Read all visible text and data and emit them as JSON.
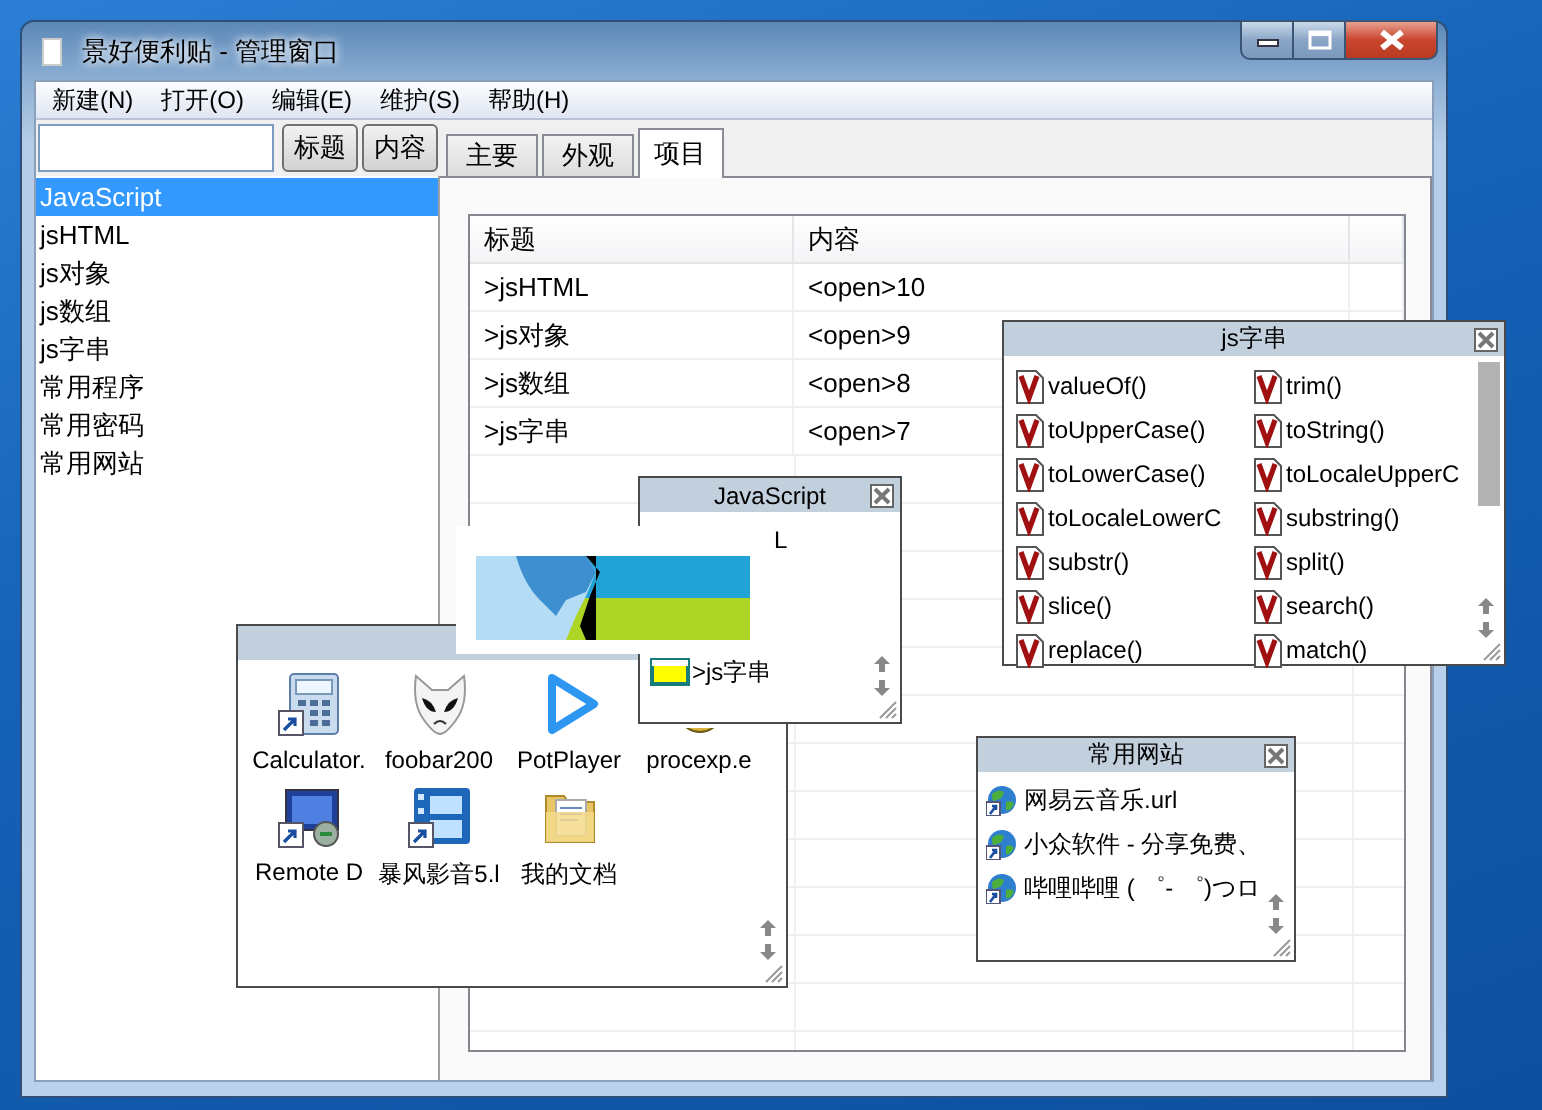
{
  "window": {
    "title": "景好便利贴 - 管理窗口"
  },
  "menu": [
    {
      "label": "新建(N)"
    },
    {
      "label": "打开(O)"
    },
    {
      "label": "编辑(E)"
    },
    {
      "label": "维护(S)"
    },
    {
      "label": "帮助(H)"
    }
  ],
  "search_buttons": [
    "标题",
    "内容"
  ],
  "tabs": [
    {
      "label": "主要",
      "selected": false
    },
    {
      "label": "外观",
      "selected": false
    },
    {
      "label": "项目",
      "selected": true
    }
  ],
  "sidebar": {
    "items": [
      {
        "label": "JavaScript",
        "selected": true
      },
      {
        "label": "jsHTML",
        "selected": false
      },
      {
        "label": "js对象",
        "selected": false
      },
      {
        "label": "js数组",
        "selected": false
      },
      {
        "label": "js字串",
        "selected": false
      },
      {
        "label": "常用程序",
        "selected": false
      },
      {
        "label": "常用密码",
        "selected": false
      },
      {
        "label": "常用网站",
        "selected": false
      }
    ]
  },
  "table": {
    "columns": [
      "标题",
      "内容"
    ],
    "rows": [
      [
        ">jsHTML",
        "<open>10"
      ],
      [
        ">js对象",
        "<open>9"
      ],
      [
        ">js数组",
        "<open>8"
      ],
      [
        ">js字串",
        "<open>7"
      ]
    ]
  },
  "notes": [
    {
      "kind": "program-grid",
      "items": [
        "Calculator.",
        "foobar200",
        "PotPlayer",
        "procexp.e",
        "Remote D",
        "暴风影音5.l",
        "我的文档"
      ]
    },
    {
      "kind": "page-list",
      "title": "JavaScript",
      "items": [
        "L",
        ">js字串"
      ]
    },
    {
      "kind": "method-grid",
      "title": "js字串",
      "items": [
        "valueOf()",
        "trim()",
        "toUpperCase()",
        "toString()",
        "toLowerCase()",
        "toLocaleUpperC",
        "toLocaleLowerC",
        "substring()",
        "substr()",
        "split()",
        "slice()",
        "search()",
        "replace()",
        "match()"
      ]
    },
    {
      "kind": "link-list",
      "title": "常用网站",
      "items": [
        "网易云音乐.url",
        "小众软件 - 分享免费、",
        "哔哩哔哩 ( ゜- ゜)つロ"
      ]
    }
  ]
}
